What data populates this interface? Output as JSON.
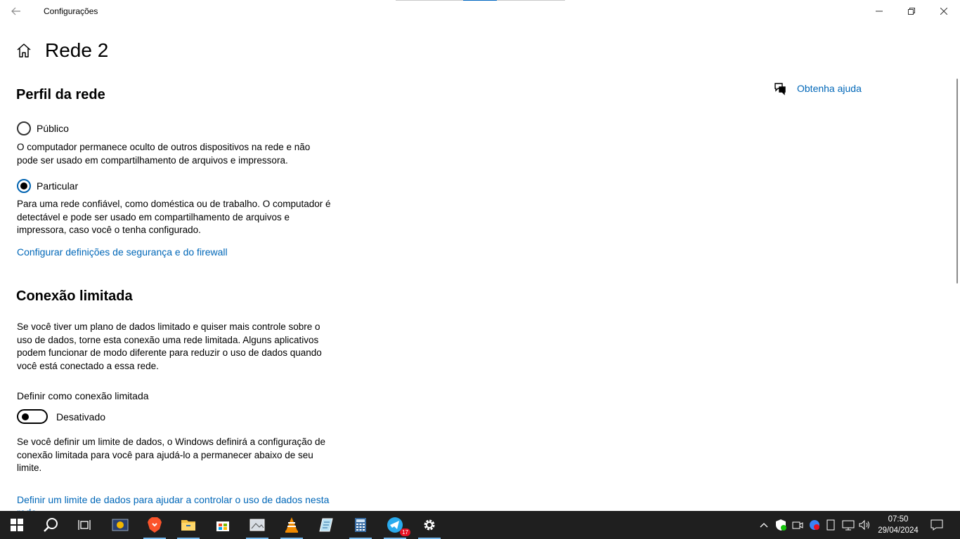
{
  "window": {
    "title": "Configurações"
  },
  "page": {
    "title": "Rede 2"
  },
  "profile": {
    "heading": "Perfil da rede",
    "public_label": "Público",
    "public_desc": "O computador permanece oculto de outros dispositivos na rede e não pode ser usado em compartilhamento de arquivos e impressora.",
    "private_label": "Particular",
    "private_desc": "Para uma rede confiável, como doméstica ou de trabalho. O computador é detectável e pode ser usado em compartilhamento de arquivos e impressora, caso você o tenha configurado.",
    "selected": "Particular",
    "firewall_link": "Configurar definições de segurança e do firewall"
  },
  "metered": {
    "heading": "Conexão limitada",
    "desc": "Se você tiver um plano de dados limitado e quiser mais controle sobre o uso de dados, torne esta conexão uma rede limitada. Alguns aplicativos podem funcionar de modo diferente para reduzir o uso de dados quando você está conectado a essa rede.",
    "toggle_label": "Definir como conexão limitada",
    "toggle_state": "Desativado",
    "limit_desc": "Se você definir um limite de dados, o Windows definirá a configuração de conexão limitada para você para ajudá-lo a permanecer abaixo de seu limite.",
    "limit_link": "Definir um limite de dados para ajudar a controlar o uso de dados nesta rede"
  },
  "help": {
    "label": "Obtenha ajuda"
  },
  "taskbar": {
    "apps": [
      "start-icon",
      "search-icon",
      "task-view-icon",
      "app-icon",
      "brave-icon",
      "file-explorer-icon",
      "store-icon",
      "photos-icon",
      "vlc-icon",
      "notepad-icon",
      "calculator-icon",
      "telegram-icon",
      "settings-icon"
    ],
    "telegram_badge": "17",
    "time": "07:50",
    "date": "29/04/2024"
  },
  "colors": {
    "accent": "#0067b8",
    "taskbar": "#1f1f1f"
  }
}
